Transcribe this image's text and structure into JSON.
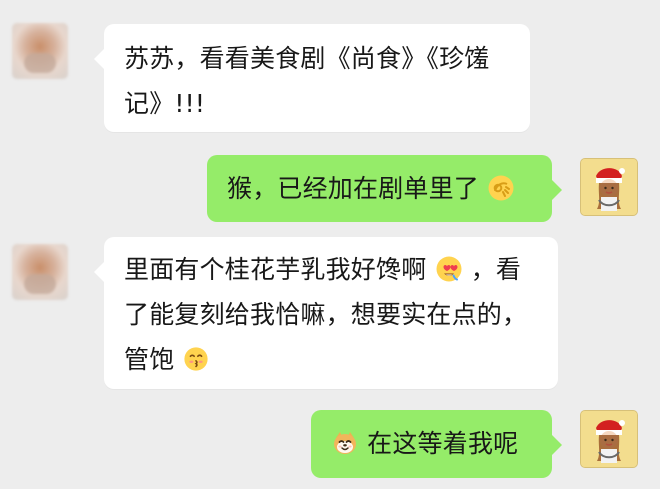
{
  "messages": [
    {
      "side": "left",
      "text": "苏苏，看看美食剧《尚食》《珍馐记》!!!"
    },
    {
      "side": "right",
      "text": "猴，已经加在剧单里了",
      "trailing_icon": "ok-hand-icon"
    },
    {
      "side": "left",
      "text_part_1": "里面有个桂花芋乳我好馋啊",
      "text_part_2": "，看了能复刻给我恰嘛，想要实在点的，管饱",
      "inline_icon": "heart-eyes-icon",
      "trailing_icon": "kiss-face-icon"
    },
    {
      "side": "right",
      "text": "在这等着我呢",
      "leading_icon": "dog-face-icon"
    }
  ],
  "colors": {
    "background": "#ededed",
    "incoming_bubble": "#ffffff",
    "outgoing_bubble": "#95ec69"
  }
}
